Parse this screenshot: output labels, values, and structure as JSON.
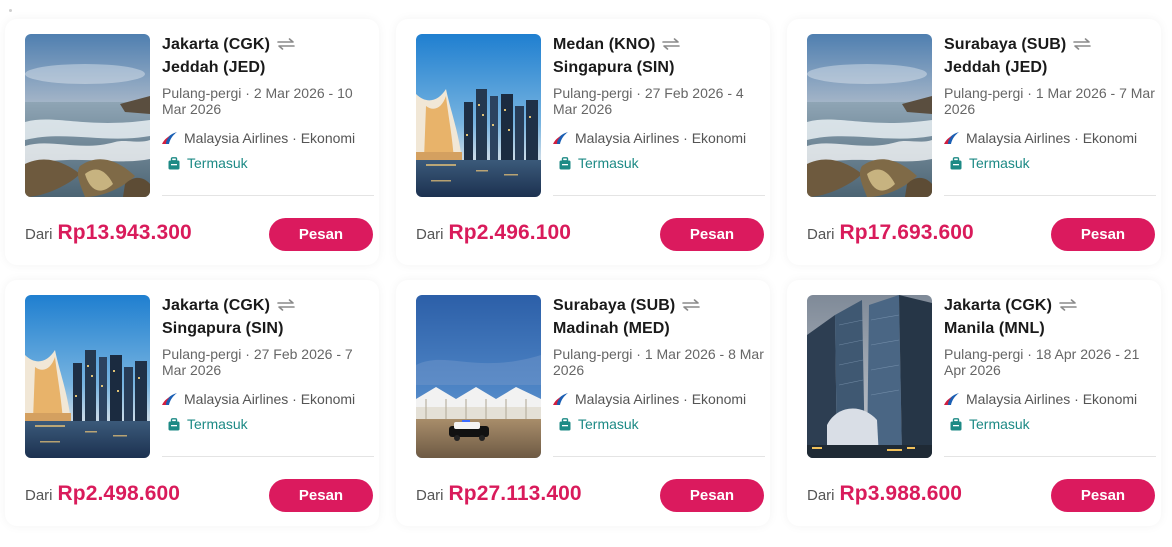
{
  "colors": {
    "accent": "#db1a5e",
    "price": "#d91b5b",
    "baggage": "#1d8a85",
    "airline_logo": "#1a5fb4"
  },
  "cards": [
    {
      "origin": "Jakarta (CGK)",
      "destination": "Jeddah (JED)",
      "dates": "Pulang-pergi · 2 Mar 2026 - 10 Mar 2026",
      "airline": "Malaysia Airlines · Ekonomi",
      "baggage": "Termasuk",
      "from_label": "Dari",
      "price": "Rp13.943.300",
      "button": "Pesan",
      "image": "coast-waves"
    },
    {
      "origin": "Medan (KNO)",
      "destination": "Singapura (SIN)",
      "dates": "Pulang-pergi · 27 Feb 2026 - 4 Mar 2026",
      "airline": "Malaysia Airlines · Ekonomi",
      "baggage": "Termasuk",
      "from_label": "Dari",
      "price": "Rp2.496.100",
      "button": "Pesan",
      "image": "singapore-skyline"
    },
    {
      "origin": "Surabaya (SUB)",
      "destination": "Jeddah (JED)",
      "dates": "Pulang-pergi · 1 Mar 2026 - 7 Mar 2026",
      "airline": "Malaysia Airlines · Ekonomi",
      "baggage": "Termasuk",
      "from_label": "Dari",
      "price": "Rp17.693.600",
      "button": "Pesan",
      "image": "coast-waves"
    },
    {
      "origin": "Jakarta (CGK)",
      "destination": "Singapura (SIN)",
      "dates": "Pulang-pergi · 27 Feb 2026 - 7 Mar 2026",
      "airline": "Malaysia Airlines · Ekonomi",
      "baggage": "Termasuk",
      "from_label": "Dari",
      "price": "Rp2.498.600",
      "button": "Pesan",
      "image": "singapore-skyline"
    },
    {
      "origin": "Surabaya (SUB)",
      "destination": "Madinah (MED)",
      "dates": "Pulang-pergi · 1 Mar 2026 - 8 Mar 2026",
      "airline": "Malaysia Airlines · Ekonomi",
      "baggage": "Termasuk",
      "from_label": "Dari",
      "price": "Rp27.113.400",
      "button": "Pesan",
      "image": "madinah-plaza"
    },
    {
      "origin": "Jakarta (CGK)",
      "destination": "Manila (MNL)",
      "dates": "Pulang-pergi · 18 Apr 2026 - 21 Apr 2026",
      "airline": "Malaysia Airlines · Ekonomi",
      "baggage": "Termasuk",
      "from_label": "Dari",
      "price": "Rp3.988.600",
      "button": "Pesan",
      "image": "manila-towers"
    }
  ]
}
